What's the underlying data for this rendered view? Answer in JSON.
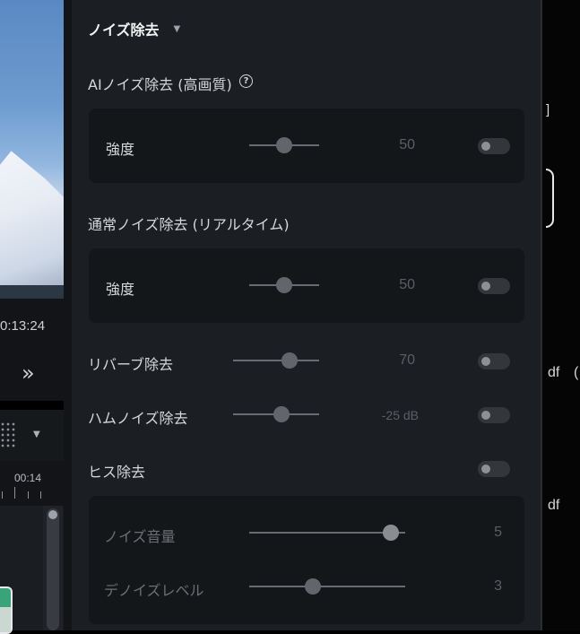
{
  "left_panel": {
    "timecode": "0:13:24",
    "forward_glyph": "»",
    "ruler_label": "00:14",
    "dropdown_caret": "▼"
  },
  "noise_panel": {
    "title": "ノイズ除去",
    "caret": "▼",
    "ai_label": "AIノイズ除去 (高画質)",
    "help_glyph": "?",
    "ai_strength": {
      "label": "強度",
      "value": "50",
      "level": 0.5,
      "enabled": false
    },
    "normal_label": "通常ノイズ除去 (リアルタイム)",
    "normal_strength": {
      "label": "強度",
      "value": "50",
      "level": 0.5,
      "enabled": false
    },
    "reverb": {
      "label": "リバーブ除去",
      "value": "70",
      "level": 0.7,
      "enabled": false
    },
    "hum": {
      "label": "ハムノイズ除去",
      "value": "-25 dB",
      "enabled": false
    },
    "hiss": {
      "label": "ヒス除去",
      "enabled": false
    },
    "hiss_noise_volume": {
      "label": "ノイズ音量",
      "value": "5"
    },
    "hiss_denoise_level": {
      "label": "デノイズレベル",
      "value": "3"
    }
  },
  "right_panel": {
    "bracket_text": "]",
    "text_1": "df",
    "text_1b": "(",
    "text_2": "df"
  },
  "colors": {
    "panel_bg": "#1b1e22",
    "card_bg": "#14171a",
    "slider_track": "#686c72",
    "toggle_off": "#33373c"
  }
}
